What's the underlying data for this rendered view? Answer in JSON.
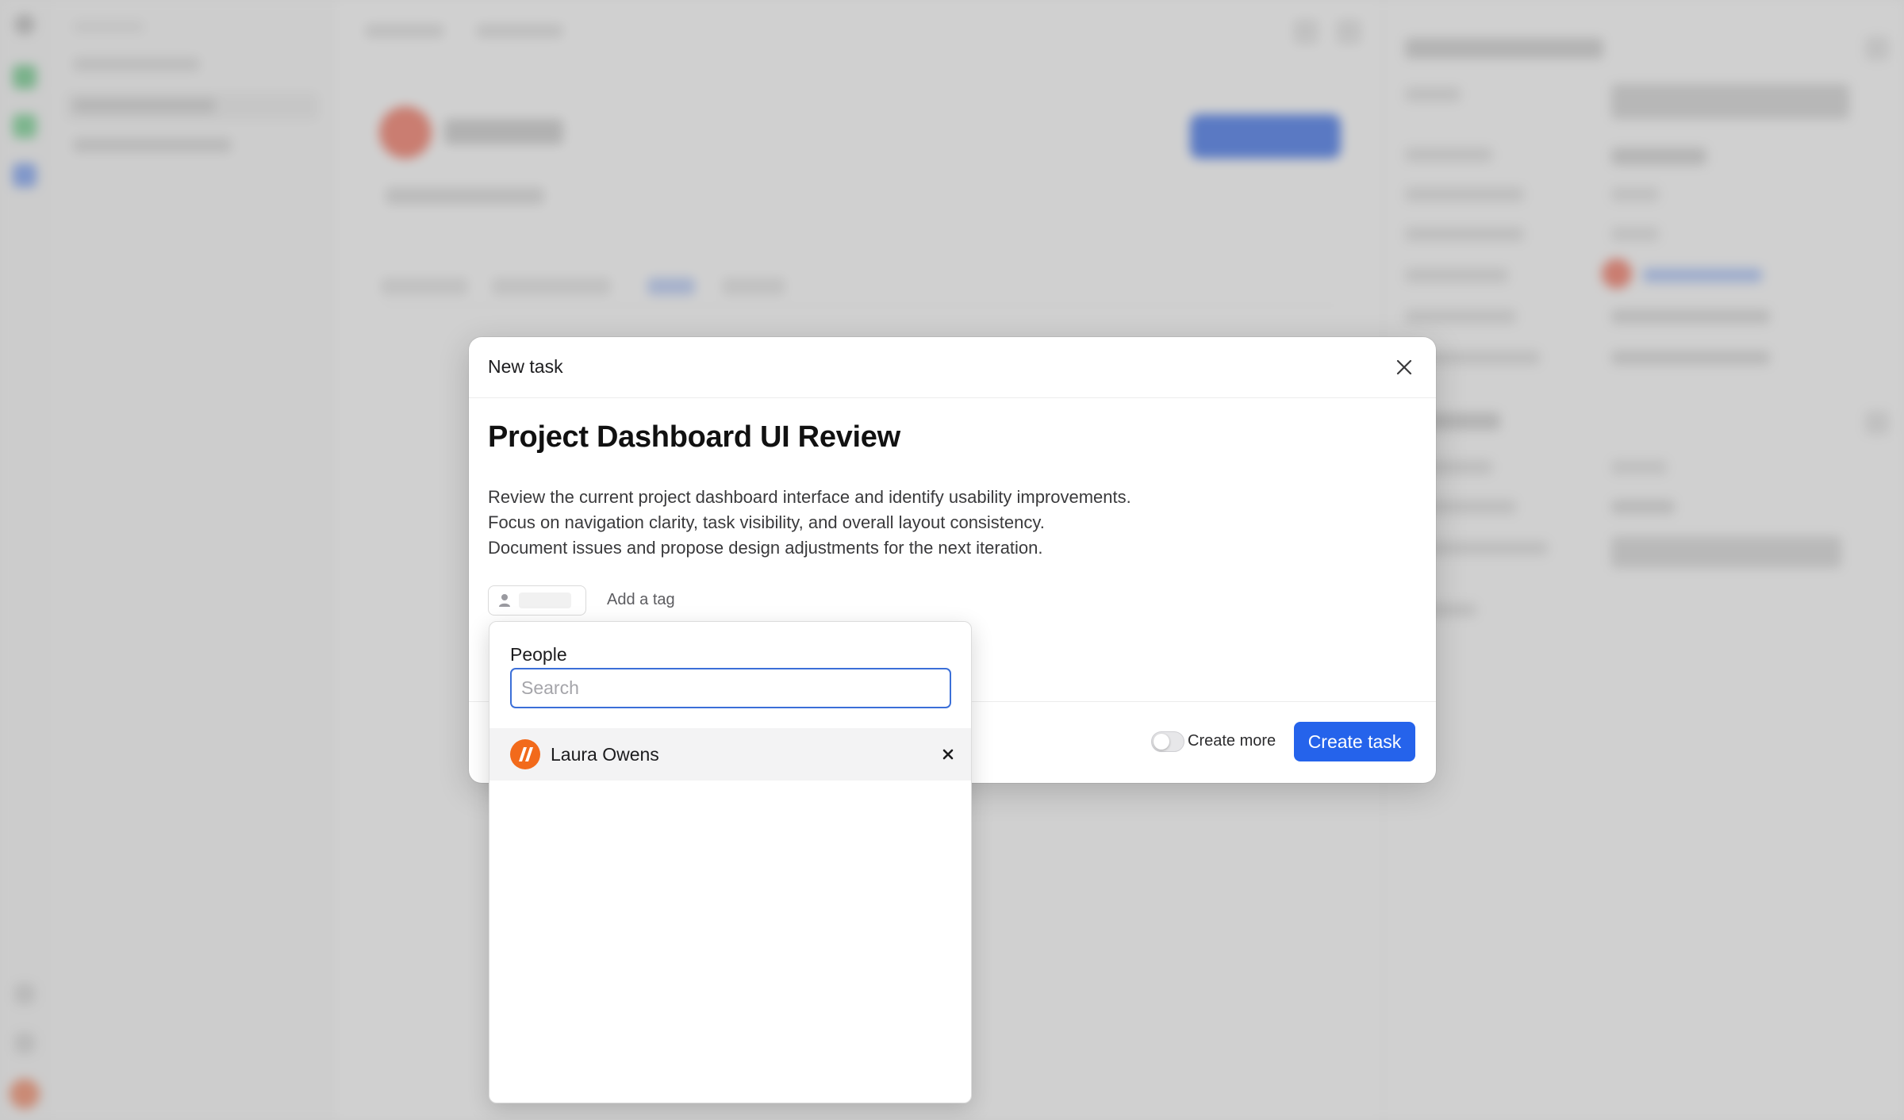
{
  "modal": {
    "title": "New task",
    "task_title": "Project Dashboard UI Review",
    "description_lines": [
      "Review the current project dashboard interface and identify usability improvements.",
      "Focus on navigation clarity, task visibility, and overall layout consistency.",
      "Document issues and propose design adjustments for the next iteration."
    ],
    "add_tag_label": "Add a tag",
    "footer": {
      "create_more_label": "Create more",
      "create_more_enabled": false,
      "create_task_label": "Create task"
    }
  },
  "people_dropdown": {
    "heading": "People",
    "search": {
      "value": "",
      "placeholder": "Search"
    },
    "people": [
      {
        "name": "Laura Owens",
        "selected": true
      }
    ]
  },
  "colors": {
    "accent": "#2563eb",
    "search_focus_border": "#3b6fd8",
    "avatar_orange": "#f26a1b"
  },
  "icons": {
    "close": "close-icon",
    "assignee": "person-icon",
    "remove": "remove-icon",
    "avatar": "brand-logo-icon"
  }
}
